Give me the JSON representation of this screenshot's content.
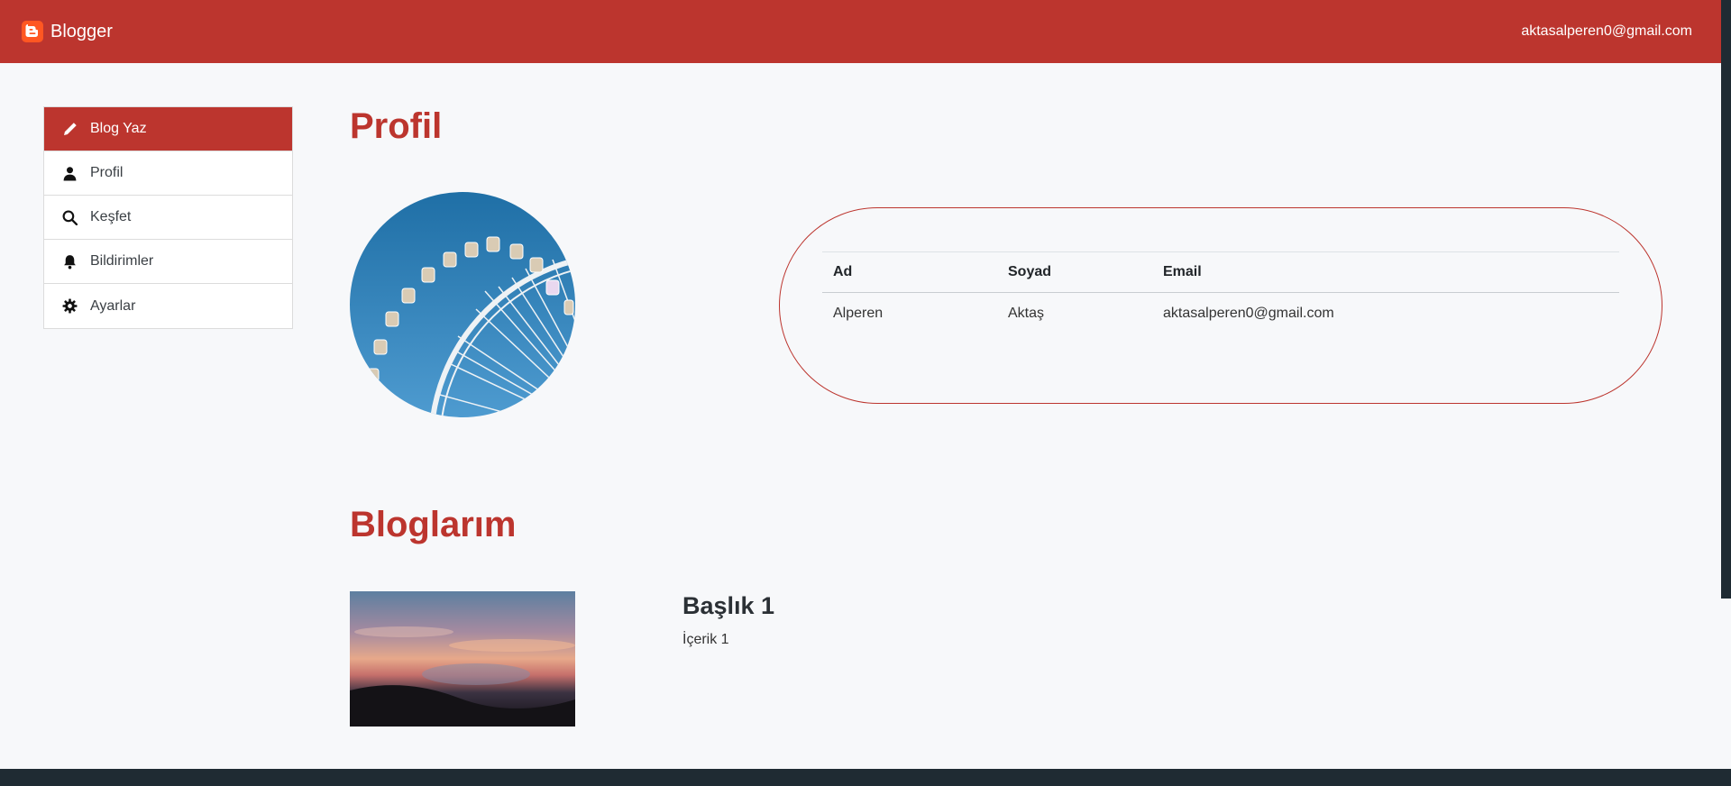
{
  "navbar": {
    "brand": "Blogger",
    "brand_icon": "blogger-logo-icon",
    "user_email": "aktasalperen0@gmail.com",
    "bg_color": "#bc352e"
  },
  "sidebar": {
    "items": [
      {
        "label": "Blog Yaz",
        "icon": "pencil-icon",
        "active": true
      },
      {
        "label": "Profil",
        "icon": "user-icon",
        "active": false
      },
      {
        "label": "Keşfet",
        "icon": "search-icon",
        "active": false
      },
      {
        "label": "Bildirimler",
        "icon": "bell-icon",
        "active": false
      },
      {
        "label": "Ayarlar",
        "icon": "gear-icon",
        "active": false
      }
    ]
  },
  "profile": {
    "heading": "Profil",
    "table": {
      "headers": [
        "Ad",
        "Soyad",
        "Email"
      ],
      "rows": [
        [
          "Alperen",
          "Aktaş",
          "aktasalperen0@gmail.com"
        ]
      ]
    }
  },
  "blogs": {
    "heading": "Bloglarım",
    "items": [
      {
        "title": "Başlık 1",
        "content": "İçerik 1"
      }
    ]
  },
  "colors": {
    "accent": "#bc352e",
    "background": "#f7f8fa",
    "dark": "#1f2b33"
  }
}
